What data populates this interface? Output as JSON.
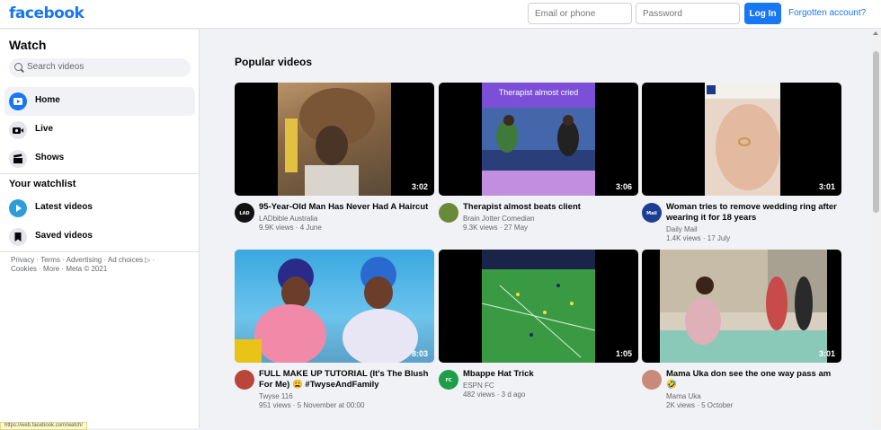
{
  "header": {
    "logo": "facebook",
    "email_placeholder": "Email or phone",
    "password_placeholder": "Password",
    "login_label": "Log In",
    "forgot_label": "Forgotten account?"
  },
  "sidebar": {
    "title": "Watch",
    "search_placeholder": "Search videos",
    "nav": [
      {
        "label": "Home",
        "icon": "home-video-icon"
      },
      {
        "label": "Live",
        "icon": "live-icon"
      },
      {
        "label": "Shows",
        "icon": "clapper-icon"
      }
    ],
    "watchlist_title": "Your watchlist",
    "watchlist": [
      {
        "label": "Latest videos",
        "icon": "play-icon"
      },
      {
        "label": "Saved videos",
        "icon": "bookmark-icon"
      }
    ],
    "footer": "Privacy · Terms · Advertising · Ad choices ▷ · Cookies · More · Meta © 2021",
    "status_url": "https://web.facebook.com/watch/"
  },
  "main": {
    "section_title": "Popular videos",
    "videos": [
      {
        "title": "95-Year-Old Man Has Never Had A Haircut",
        "channel": "LADbible Australia",
        "meta": "9.9K views · 4 June",
        "duration": "3:02"
      },
      {
        "title": "Therapist almost beats client",
        "channel": "Brain Jotter Comedian",
        "meta": "9.3K views · 27 May",
        "duration": "3:06",
        "banner": "Therapist almost cried"
      },
      {
        "title": "Woman tries to remove wedding ring after wearing it for 18 years",
        "channel": "Daily Mail",
        "meta": "1.4K views · 17 July",
        "duration": "3:01"
      },
      {
        "title": "FULL MAKE UP TUTORIAL (It's The Blush For Me) 😩 #TwyseAndFamily",
        "channel": "Twyse 116",
        "meta": "951 views · 5 November at 00:00",
        "duration": "8:03"
      },
      {
        "title": "Mbappe Hat Trick",
        "channel": "ESPN FC",
        "meta": "482 views · 3 d ago",
        "duration": "1:05"
      },
      {
        "title": "Mama Uka don see the one way pass am 🤣",
        "channel": "Mama Uka",
        "meta": "2K views · 5 October",
        "duration": "3:01"
      }
    ]
  },
  "colors": {
    "brand": "#1877f2",
    "page_bg": "#f0f2f5"
  }
}
